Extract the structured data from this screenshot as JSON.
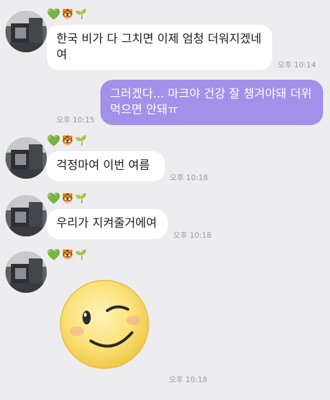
{
  "colors": {
    "background": "#ededf0",
    "incoming_bubble": "#ffffff",
    "outgoing_bubble": "#a390e8",
    "timestamp": "#9a9aa0"
  },
  "sender_badge": {
    "heart": "💚",
    "tiger": "🐯",
    "sprout": "🌱"
  },
  "messages": [
    {
      "direction": "in",
      "text": "한국 비가 다 그치면 이제 엄청 더워지겠네\n여",
      "time": "오후 10:14"
    },
    {
      "direction": "out",
      "text": "그러겠다... 마크야 건강 잘 챙겨야돼 더위\n먹으면 안돼ㅠ",
      "time": "오후 10:15"
    },
    {
      "direction": "in",
      "text": "걱정마여 이번 여름",
      "time": "오후 10:18"
    },
    {
      "direction": "in",
      "text": "우리가 지켜줄거에여",
      "time": "오후 10:18"
    },
    {
      "direction": "in",
      "sticker": "winking-smiley-sticker",
      "time": "오후 10:18"
    }
  ]
}
